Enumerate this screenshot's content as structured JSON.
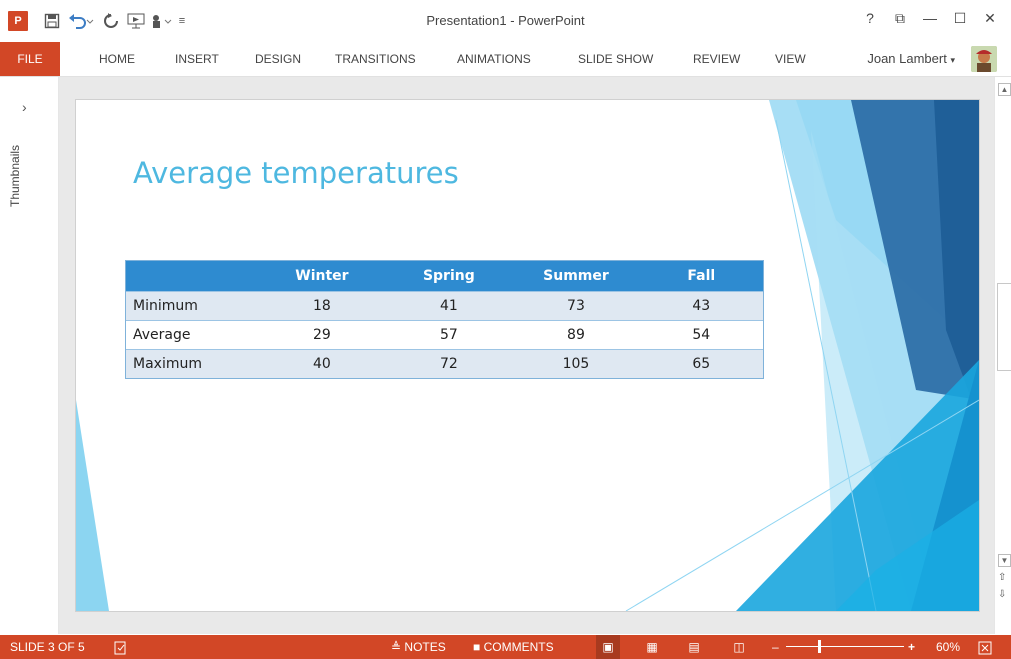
{
  "window": {
    "title": "Presentation1 - PowerPoint",
    "app_icon_label": "P",
    "help": "?",
    "controls": [
      "⧉",
      "—",
      "☐",
      "✕"
    ]
  },
  "qat": {
    "icons": [
      "save-icon",
      "undo-icon",
      "redo-icon",
      "from-beginning-icon",
      "touch-mode-icon",
      "customize-qat-icon"
    ]
  },
  "ribbon": {
    "tabs": [
      "FILE",
      "HOME",
      "INSERT",
      "DESIGN",
      "TRANSITIONS",
      "ANIMATIONS",
      "SLIDE SHOW",
      "REVIEW",
      "VIEW"
    ],
    "user": "Joan Lambert"
  },
  "thumbnails_pane": {
    "label": "Thumbnails",
    "toggle": "›"
  },
  "slide": {
    "title": "Average temperatures",
    "table": {
      "headers": [
        "",
        "Winter",
        "Spring",
        "Summer",
        "Fall"
      ],
      "rows": [
        [
          "Minimum",
          "18",
          "41",
          "73",
          "43"
        ],
        [
          "Average",
          "29",
          "57",
          "89",
          "54"
        ],
        [
          "Maximum",
          "40",
          "72",
          "105",
          "65"
        ]
      ]
    },
    "theme_colors": [
      "#4eb8e0",
      "#2e8bd0",
      "#1f6aa8",
      "#7fd0ef"
    ]
  },
  "status": {
    "slide_indicator": "SLIDE 3 OF 5",
    "notes": "NOTES",
    "comments": "COMMENTS",
    "zoom": "60%",
    "accent": "#d24726"
  }
}
